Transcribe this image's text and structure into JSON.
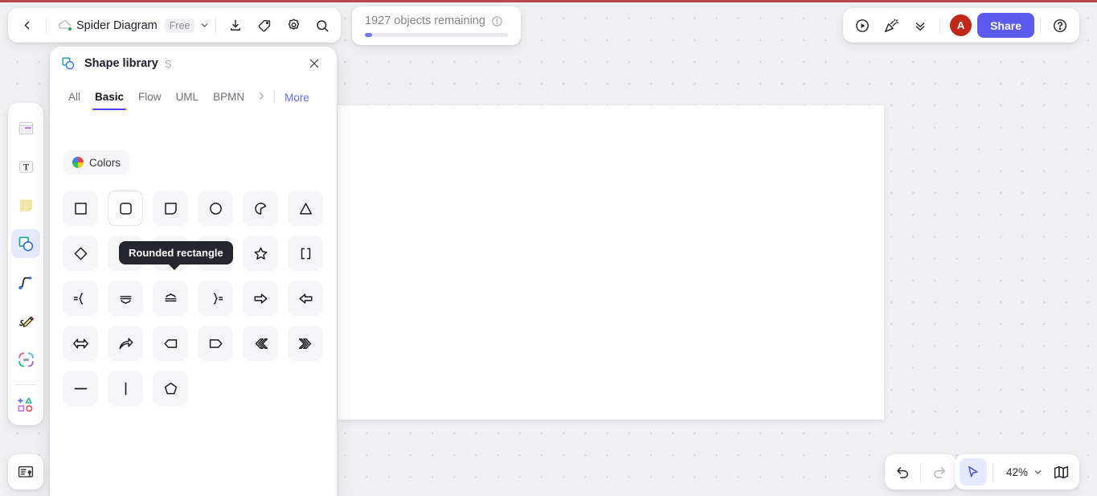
{
  "app": {
    "accent_color": "#5b5bf0",
    "tooltip_bg": "#24262d",
    "top_accent_color": "#b8484f"
  },
  "topbar": {
    "back_label": "Back",
    "document_title": "Spider Diagram",
    "plan_badge": "Free",
    "icons": {
      "back": "chevron-left-icon",
      "cloud": "cloud-saved-icon",
      "caret": "chevron-down-icon",
      "download": "download-icon",
      "tag": "tag-icon",
      "settings": "gear-icon",
      "search": "search-icon"
    }
  },
  "objects_counter": {
    "text": "1927 objects remaining",
    "info_icon": "info-icon",
    "progress_percent": 5,
    "fill_color": "#6b7bf7"
  },
  "topright": {
    "present_icon": "play-circle-icon",
    "celebrate_icon": "party-popper-icon",
    "collapse_icon": "chevrons-down-icon",
    "avatar_initial": "A",
    "avatar_color": "#c0291a",
    "share_label": "Share",
    "help_icon": "question-circle-icon"
  },
  "toolrail": {
    "items": [
      {
        "name": "frame-tool",
        "icon": "frame-icon",
        "active": false
      },
      {
        "name": "text-tool",
        "icon": "text-icon",
        "active": false
      },
      {
        "name": "sticky-note-tool",
        "icon": "sticky-note-icon",
        "active": false
      },
      {
        "name": "shapes-tool",
        "icon": "shapes-icon",
        "active": true
      },
      {
        "name": "connector-tool",
        "icon": "connector-line-icon",
        "active": false
      },
      {
        "name": "pen-tool",
        "icon": "pen-draw-icon",
        "active": false
      },
      {
        "name": "comment-tool",
        "icon": "comment-frame-icon",
        "active": false
      },
      {
        "name": "more-tools",
        "icon": "more-shapes-icon",
        "active": false
      }
    ],
    "minimap_icon": "minimap-icon"
  },
  "shape_library": {
    "title": "Shape library",
    "shortcut": "S",
    "panel_icon": "shape-library-icon",
    "close_icon": "close-icon",
    "tabs": [
      {
        "label": "All",
        "active": false
      },
      {
        "label": "Basic",
        "active": true
      },
      {
        "label": "Flow",
        "active": false
      },
      {
        "label": "UML",
        "active": false
      },
      {
        "label": "BPMN",
        "active": false
      }
    ],
    "next_tab_icon": "chevron-right-icon",
    "more_label": "More",
    "colors_label": "Colors",
    "tooltip": "Rounded rectangle",
    "shapes": [
      {
        "name": "square",
        "icon": "square-icon",
        "selected": false
      },
      {
        "name": "rounded-rectangle",
        "icon": "rounded-rectangle-icon",
        "selected": true
      },
      {
        "name": "one-corner-rounded",
        "icon": "one-corner-rounded-icon",
        "selected": false
      },
      {
        "name": "circle",
        "icon": "circle-icon",
        "selected": false
      },
      {
        "name": "pie-slice",
        "icon": "pie-slice-icon",
        "selected": false
      },
      {
        "name": "triangle",
        "icon": "triangle-icon",
        "selected": false
      },
      {
        "name": "diamond",
        "icon": "diamond-icon",
        "selected": false
      },
      {
        "name": "parallelogram",
        "icon": "parallelogram-icon",
        "selected": false
      },
      {
        "name": "rectangular-callout",
        "icon": "rectangular-callout-icon",
        "selected": false
      },
      {
        "name": "speech-bubble",
        "icon": "speech-bubble-icon",
        "selected": false
      },
      {
        "name": "star",
        "icon": "star-icon",
        "selected": false
      },
      {
        "name": "brackets",
        "icon": "brackets-icon",
        "selected": false
      },
      {
        "name": "left-brace",
        "icon": "left-brace-icon",
        "selected": false
      },
      {
        "name": "down-brace",
        "icon": "down-brace-icon",
        "selected": false
      },
      {
        "name": "up-brace",
        "icon": "up-brace-icon",
        "selected": false
      },
      {
        "name": "right-brace",
        "icon": "right-brace-icon",
        "selected": false
      },
      {
        "name": "right-arrow",
        "icon": "right-arrow-icon",
        "selected": false
      },
      {
        "name": "left-arrow",
        "icon": "left-arrow-icon",
        "selected": false
      },
      {
        "name": "double-arrow",
        "icon": "double-arrow-icon",
        "selected": false
      },
      {
        "name": "curved-arrow",
        "icon": "curved-arrow-icon",
        "selected": false
      },
      {
        "name": "left-pentagon-arrow",
        "icon": "left-pentagon-arrow-icon",
        "selected": false
      },
      {
        "name": "right-pentagon-tag",
        "icon": "right-pentagon-tag-icon",
        "selected": false
      },
      {
        "name": "left-chevron",
        "icon": "left-chevron-icon",
        "selected": false
      },
      {
        "name": "right-chevron",
        "icon": "right-chevron-icon",
        "selected": false
      },
      {
        "name": "horizontal-line",
        "icon": "horizontal-line-icon",
        "selected": false
      },
      {
        "name": "vertical-line",
        "icon": "vertical-line-icon",
        "selected": false
      },
      {
        "name": "pentagon",
        "icon": "pentagon-icon",
        "selected": false
      }
    ]
  },
  "bottombar": {
    "undo_icon": "undo-icon",
    "redo_icon": "redo-icon",
    "redo_disabled": true,
    "cursor_icon": "cursor-arrow-icon",
    "zoom_level": "42%",
    "zoom_caret_icon": "chevron-down-icon",
    "minimap_icon": "book-map-icon"
  }
}
